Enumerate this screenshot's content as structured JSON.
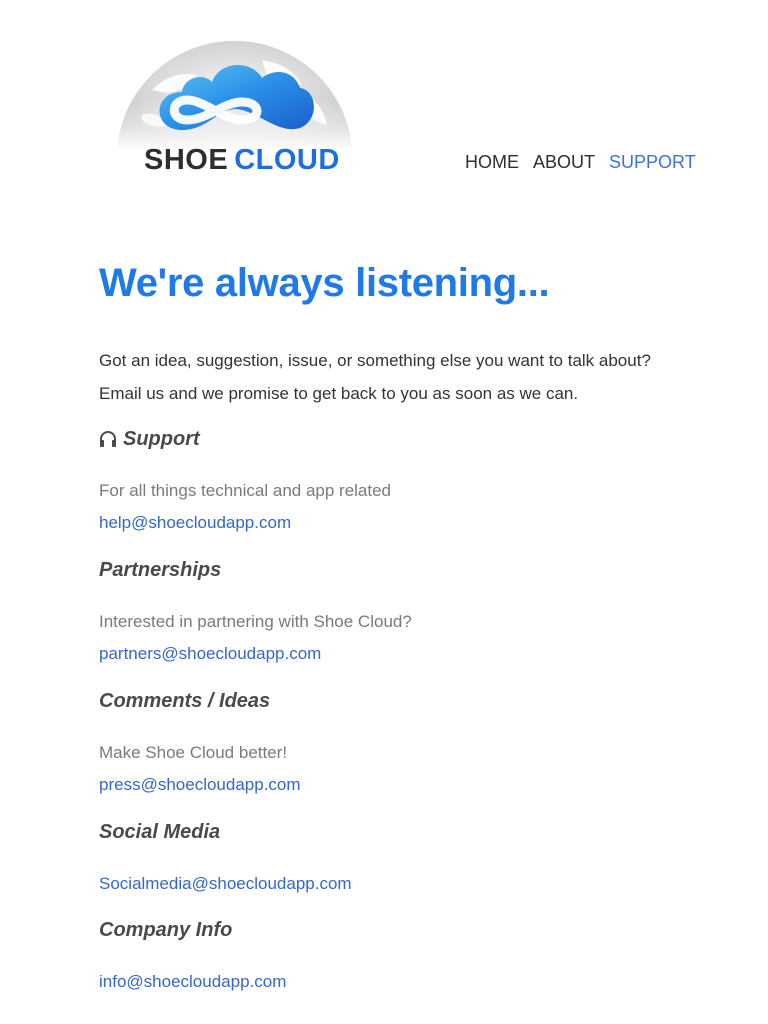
{
  "logo": {
    "word1": "SHOE",
    "word2": "CLOUD",
    "icon": "cloud-globe-logo"
  },
  "nav": {
    "items": [
      {
        "label": "HOME",
        "active": false
      },
      {
        "label": "ABOUT",
        "active": false
      },
      {
        "label": "SUPPORT",
        "active": true
      }
    ]
  },
  "main": {
    "headline": "We're always listening...",
    "intro_line1": "Got an idea, suggestion, issue, or something else you want to talk about?",
    "intro_line2": "Email us and we promise to get back to you as soon as we can.",
    "sections": [
      {
        "title": "Support",
        "icon": "headphones-icon",
        "description": "For all things technical and app related",
        "email": "help@shoecloudapp.com"
      },
      {
        "title": "Partnerships",
        "description": "Interested in partnering with Shoe Cloud?",
        "email": "partners@shoecloudapp.com"
      },
      {
        "title": "Comments / Ideas",
        "description": "Make Shoe Cloud better!",
        "email": "press@shoecloudapp.com"
      },
      {
        "title": "Social Media",
        "email": "Socialmedia@shoecloudapp.com"
      },
      {
        "title": "Company Info",
        "email": "info@shoecloudapp.com"
      }
    ]
  },
  "colors": {
    "accent": "#1f7ae6",
    "link": "#3567c9",
    "nav_active": "#3b72d9"
  }
}
